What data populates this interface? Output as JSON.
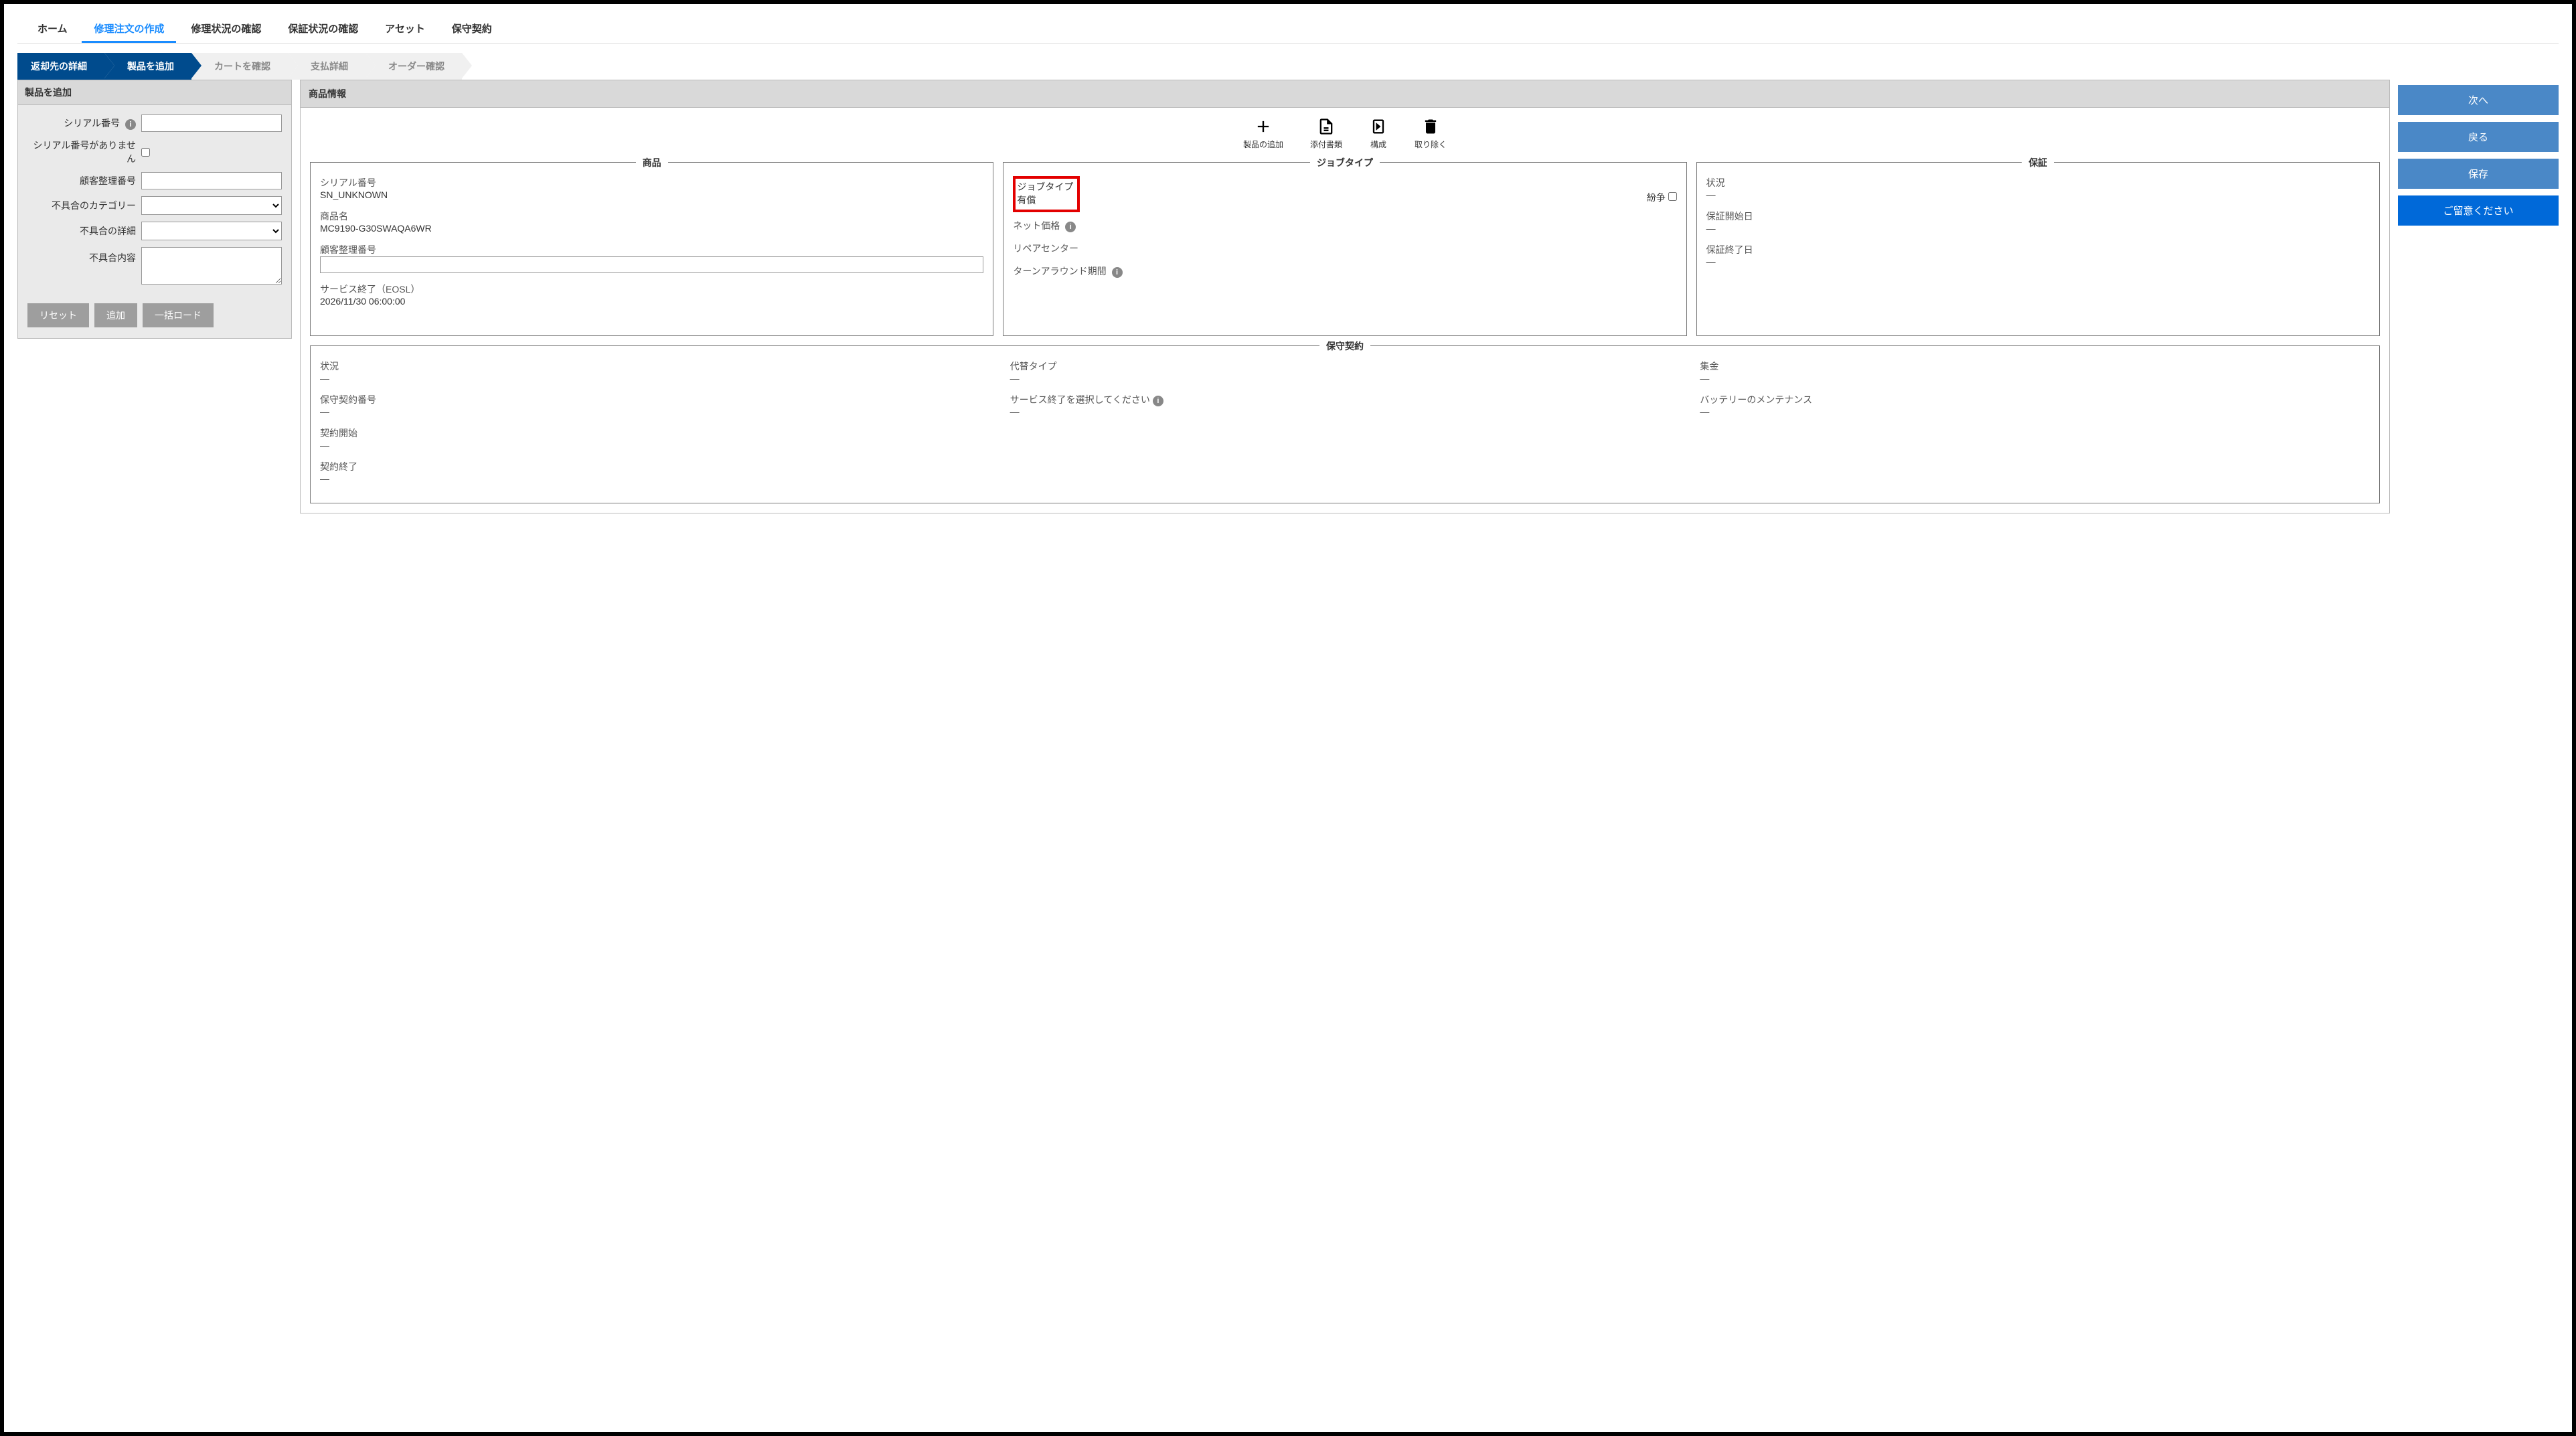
{
  "tabs": {
    "home": "ホーム",
    "createOrder": "修理注文の作成",
    "repairStatus": "修理状況の確認",
    "warrantyStatus": "保証状況の確認",
    "asset": "アセット",
    "contract": "保守契約"
  },
  "steps": {
    "returnDetail": "返却先の詳細",
    "addProduct": "製品を追加",
    "reviewCart": "カートを確認",
    "paymentDetail": "支払詳細",
    "orderConfirm": "オーダー確認"
  },
  "leftPanel": {
    "title": "製品を追加",
    "serialLabel": "シリアル番号",
    "noSerialLabel": "シリアル番号がありません",
    "customerRefLabel": "顧客整理番号",
    "problemCategoryLabel": "不具合のカテゴリー",
    "problemDetailLabel": "不具合の詳細",
    "problemDescLabel": "不具合内容",
    "btnReset": "リセット",
    "btnAdd": "追加",
    "btnBulkLoad": "一括ロード"
  },
  "midPanel": {
    "title": "商品情報",
    "tools": {
      "addProduct": "製品の追加",
      "attachments": "添付書類",
      "configure": "構成",
      "remove": "取り除く"
    },
    "productBox": {
      "legend": "商品",
      "serialLabel": "シリアル番号",
      "serialValue": "SN_UNKNOWN",
      "productNameLabel": "商品名",
      "productNameValue": "MC9190-G30SWAQA6WR",
      "customerRefLabel": "顧客整理番号",
      "eoslLabel": "サービス終了（EOSL）",
      "eoslValue": "2026/11/30 06:00:00"
    },
    "jobBox": {
      "legend": "ジョブタイプ",
      "jobTypeLabel": "ジョブタイプ",
      "jobTypeValue": "有償",
      "disputeLabel": "紛争",
      "netPriceLabel": "ネット価格",
      "repairCenterLabel": "リペアセンター",
      "tatLabel": "ターンアラウンド期間"
    },
    "warrantyBox": {
      "legend": "保証",
      "statusLabel": "状況",
      "startLabel": "保証開始日",
      "endLabel": "保証終了日"
    },
    "contractBox": {
      "legend": "保守契約",
      "statusLabel": "状況",
      "contractNoLabel": "保守契約番号",
      "contractStartLabel": "契約開始",
      "contractEndLabel": "契約終了",
      "replaceTypeLabel": "代替タイプ",
      "selectEoslLabel": "サービス終了を選択してください",
      "collectLabel": "集金",
      "batteryLabel": "バッテリーのメンテナンス"
    }
  },
  "rightPanel": {
    "next": "次へ",
    "back": "戻る",
    "save": "保存",
    "note": "ご留意ください"
  },
  "common": {
    "mdash": "—"
  }
}
